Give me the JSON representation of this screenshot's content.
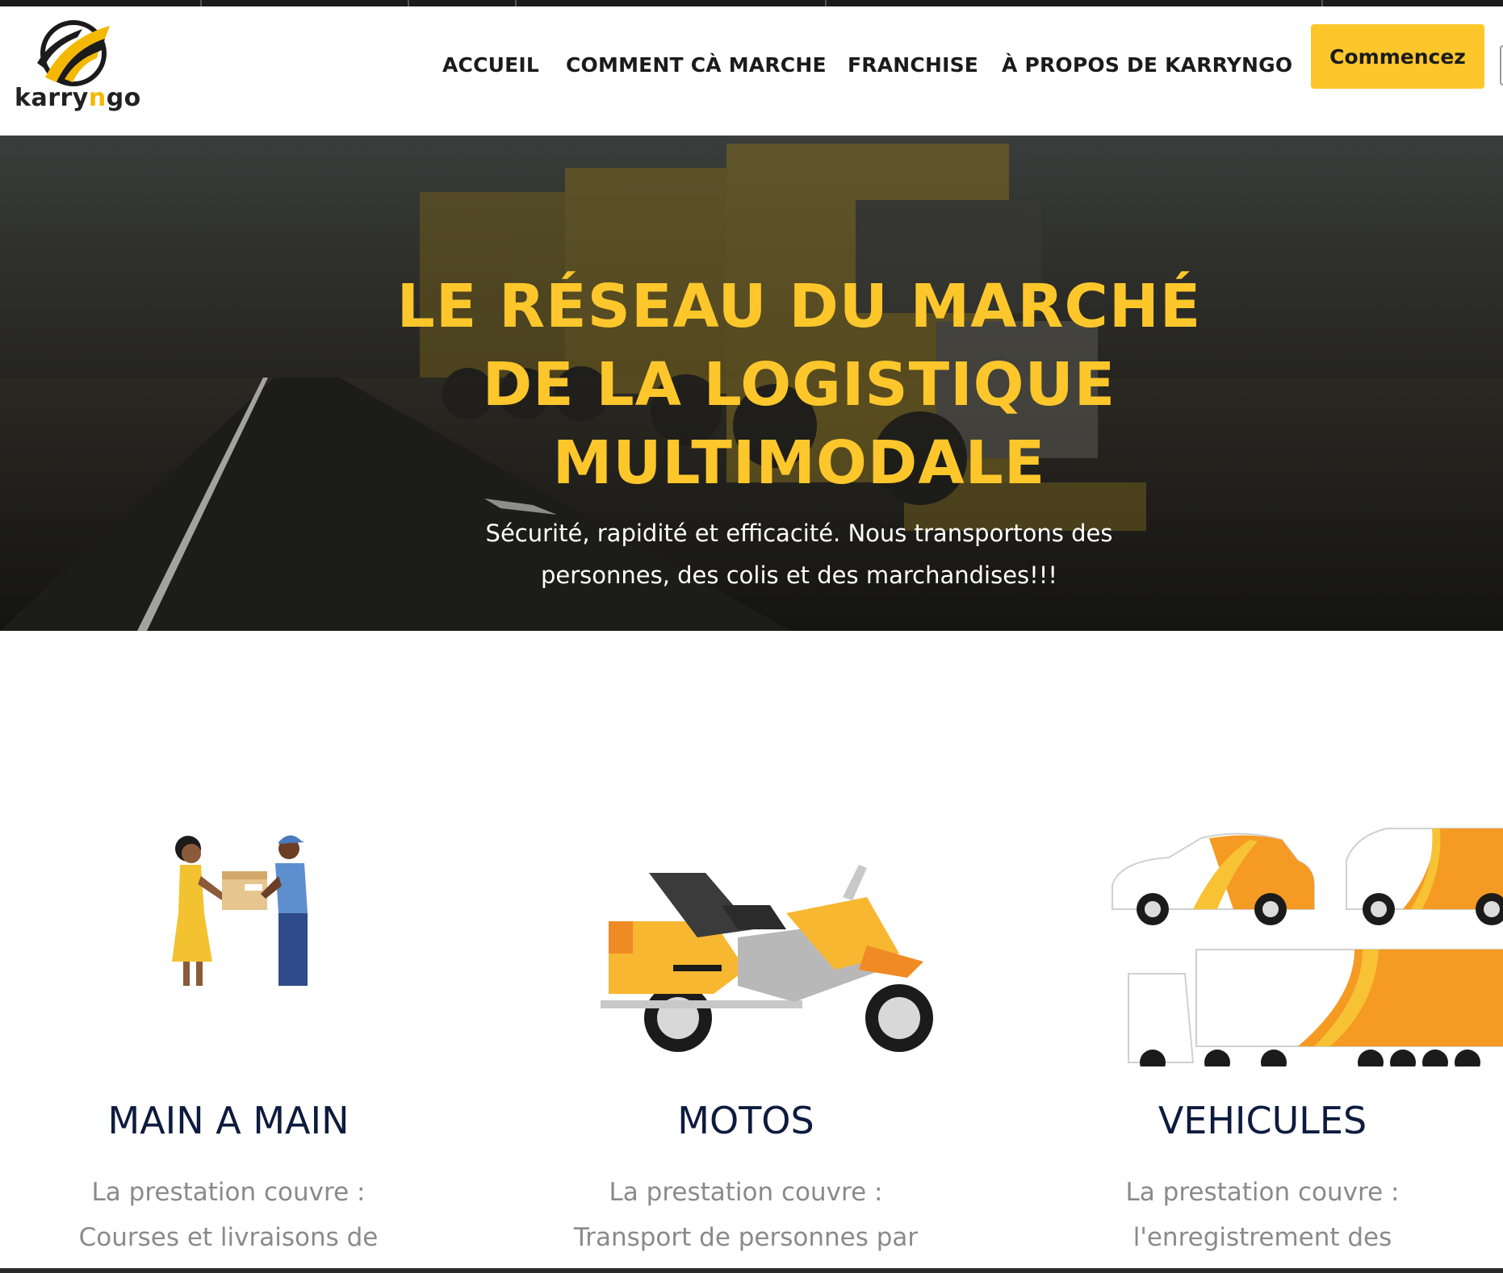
{
  "brand": {
    "logo_text_prefix": "karry",
    "logo_text_accent": "n",
    "logo_text_suffix": "go",
    "accent_color": "#fdc72c"
  },
  "nav": {
    "items": [
      {
        "label": "ACCUEIL"
      },
      {
        "label": "COMMENT CÀ MARCHE"
      },
      {
        "label": "FRANCHISE"
      },
      {
        "label": "À PROPOS DE KARRYNGO"
      }
    ],
    "cta_label": "Commencez"
  },
  "hero": {
    "title_line1": "LE RÉSEAU DU MARCHÉ",
    "title_line2": "DE LA LOGISTIQUE",
    "title_line3": "MULTIMODALE",
    "subtitle_line1": "Sécurité, rapidité et efficacité. Nous transportons des",
    "subtitle_line2": "personnes, des colis et des marchandises!!!",
    "background": "truck-on-highway-photo"
  },
  "services": [
    {
      "icon": "hand-to-hand-delivery-icon",
      "title": "MAIN A MAIN",
      "text_line1": "La prestation couvre :",
      "text_line2": "Courses et livraisons de"
    },
    {
      "icon": "motorcycle-icon",
      "title": "MOTOS",
      "text_line1": "La prestation couvre :",
      "text_line2": "Transport de personnes par"
    },
    {
      "icon": "vehicles-fleet-icon",
      "title": "VEHICULES",
      "text_line1": "La prestation couvre :",
      "text_line2": "l'enregistrement des"
    }
  ]
}
